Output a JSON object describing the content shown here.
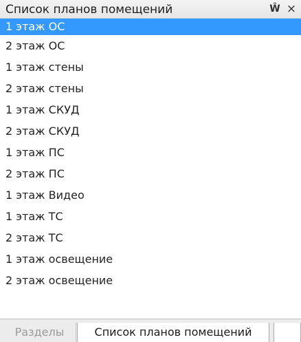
{
  "panel": {
    "title": "Список планов помещений",
    "pin_icon": "pin-icon",
    "pin_symbol": "ꟷ",
    "close_icon": "close-icon",
    "close_symbol": "×"
  },
  "list": {
    "selected_index": 0,
    "items": [
      "1 этаж ОС",
      "2 этаж ОС",
      "1 этаж стены",
      "2 этаж стены",
      "1 этаж СКУД",
      "2 этаж СКУД",
      "1 этаж ПС",
      "2 этаж ПС",
      "1 этаж Видео",
      "1 этаж ТС",
      "2 этаж ТС",
      "1 этаж освещение",
      "2 этаж освещение"
    ]
  },
  "tabs": [
    {
      "label": "Разделы",
      "active": false
    },
    {
      "label": "Список планов помещений",
      "active": true
    }
  ],
  "colors": {
    "selection": "#3399ff",
    "inactive_tab_text": "#9a9a9a"
  }
}
